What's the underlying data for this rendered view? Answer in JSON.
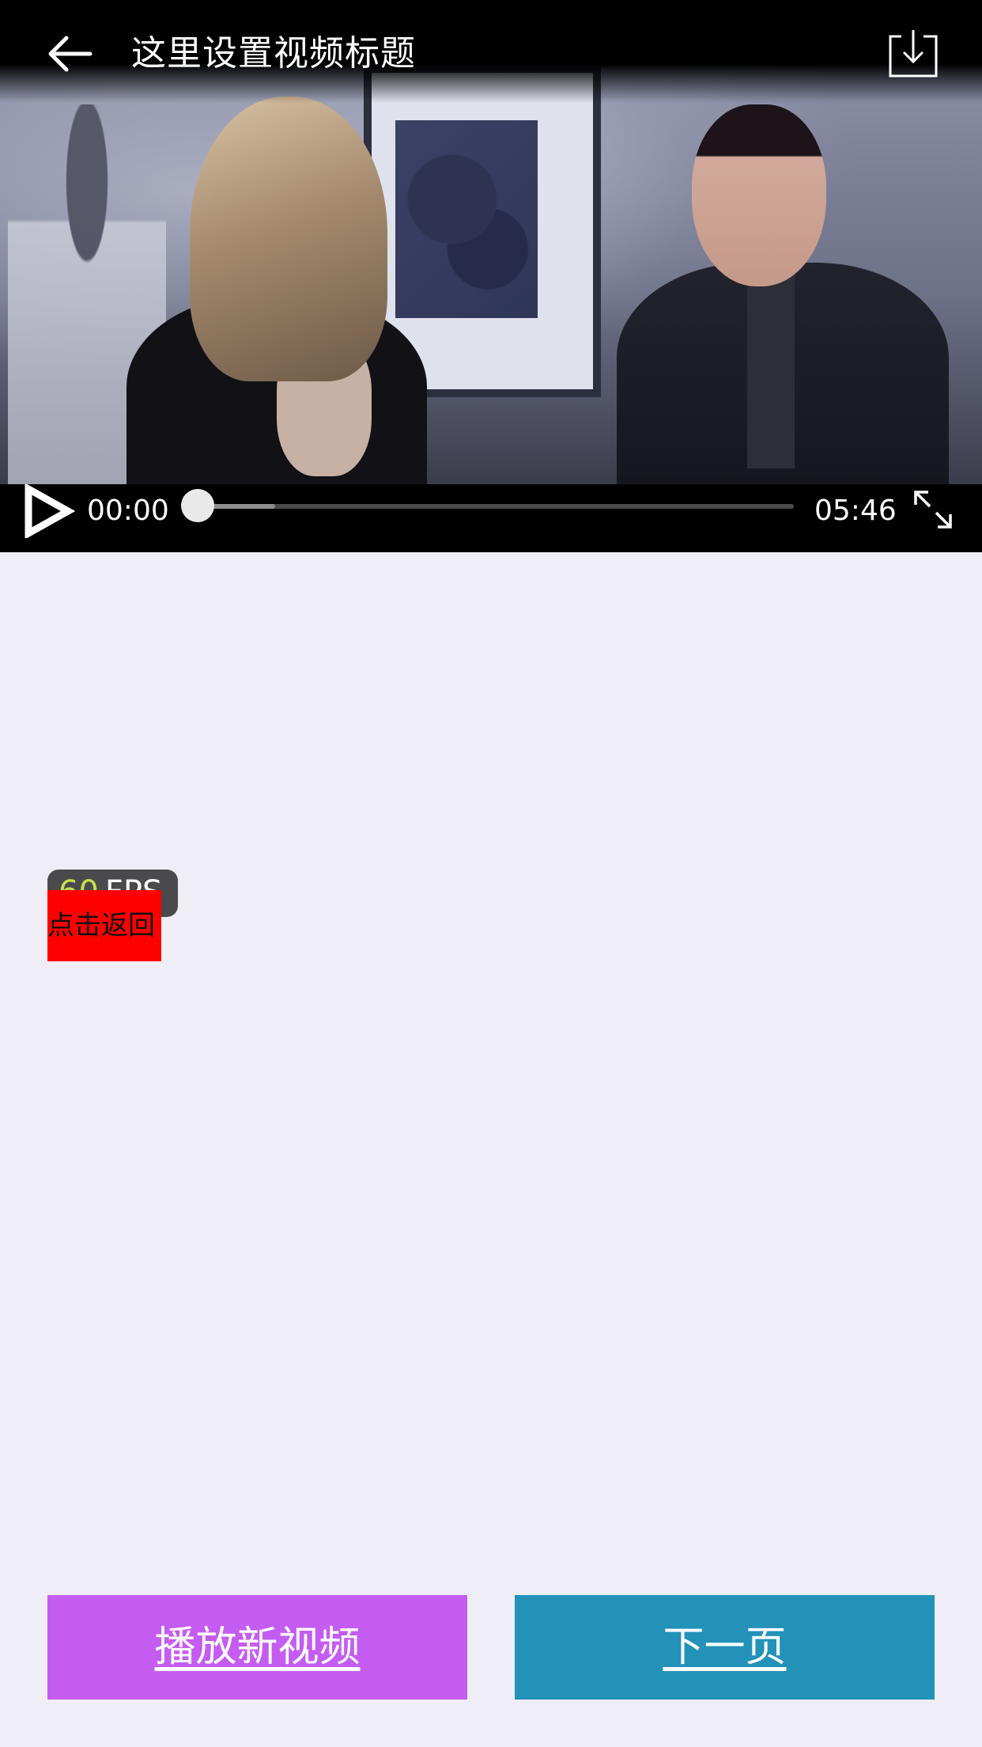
{
  "header": {
    "title": "这里设置视频标题",
    "back_icon": "back-arrow-icon",
    "download_icon": "download-icon"
  },
  "player": {
    "current_time": "00:00",
    "total_time": "05:46",
    "played_fraction": 0.0,
    "buffered_fraction": 0.13,
    "play_icon": "play-icon",
    "fullscreen_icon": "fullscreen-icon"
  },
  "fps": {
    "value": "60",
    "unit": "FPS"
  },
  "tap_back": {
    "label": "点击返回"
  },
  "buttons": {
    "play_new_label": "播放新视频",
    "next_page_label": "下一页"
  },
  "colors": {
    "page_background": "#efeef7",
    "play_new_button": "#c55cf2",
    "next_page_button": "#2292b8",
    "tap_back_button": "#ff0000",
    "fps_value": "#c8e04a"
  }
}
